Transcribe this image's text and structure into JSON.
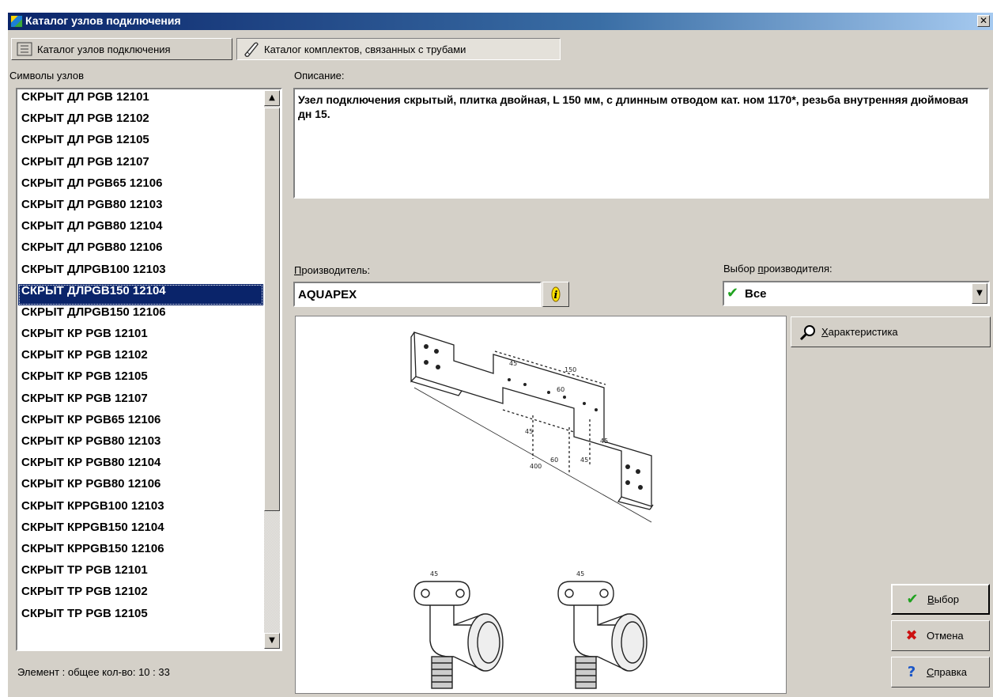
{
  "window": {
    "title": "Каталог узлов подключения",
    "close_glyph": "✕"
  },
  "tabs": [
    {
      "label": "Каталог узлов подключения",
      "icon": "list-icon"
    },
    {
      "label": "Каталог комплектов, связанных с трубами",
      "icon": "pipe-icon"
    }
  ],
  "list": {
    "label": "Символы узлов",
    "selected_index": 9,
    "items": [
      "СКРЫТ ДЛ PGB 12101",
      "СКРЫТ ДЛ PGB 12102",
      "СКРЫТ ДЛ PGB 12105",
      "СКРЫТ ДЛ PGB 12107",
      "СКРЫТ ДЛ PGB65 12106",
      "СКРЫТ ДЛ PGB80 12103",
      "СКРЫТ ДЛ PGB80 12104",
      "СКРЫТ ДЛ PGB80 12106",
      "СКРЫТ ДЛPGB100 12103",
      "СКРЫТ ДЛPGB150 12104",
      "СКРЫТ ДЛPGB150 12106",
      "СКРЫТ КР PGB 12101",
      "СКРЫТ КР PGB 12102",
      "СКРЫТ КР PGB 12105",
      "СКРЫТ КР PGB 12107",
      "СКРЫТ КР PGB65 12106",
      "СКРЫТ КР PGB80 12103",
      "СКРЫТ КР PGB80 12104",
      "СКРЫТ КР PGB80 12106",
      "СКРЫТ КРPGB100 12103",
      "СКРЫТ КРPGB150 12104",
      "СКРЫТ КРPGB150 12106",
      "СКРЫТ ТР PGB 12101",
      "СКРЫТ ТР PGB 12102",
      "СКРЫТ ТР PGB 12105"
    ]
  },
  "description": {
    "label": "Описание:",
    "text": "Узел подключения скрытый, плитка двойная, L 150 мм, с длинным отводом кат. ном 1170*, резьба внутренняя дюймовая дн 15."
  },
  "manufacturer": {
    "label_u": "П",
    "label_rest": "роизводитель:",
    "value": "AQUAPEX",
    "info_icon": "info-icon"
  },
  "manufacturer_select": {
    "label_pre": "Выбор ",
    "label_u": "п",
    "label_rest": "роизводителя:",
    "value": "Все",
    "icon": "check-icon"
  },
  "drawing": {
    "dims": [
      "150",
      "60",
      "45",
      "45",
      "45",
      "60",
      "45",
      "400",
      "45",
      "45"
    ]
  },
  "buttons": {
    "characteristic": {
      "u": "Х",
      "rest": "арактеристика"
    },
    "ok": {
      "u": "В",
      "rest": "ыбор"
    },
    "cancel": {
      "label": "Отмена"
    },
    "help": {
      "u": "С",
      "rest": "правка"
    }
  },
  "status": "Элемент : общее кол-во: 10 : 33",
  "colors": {
    "title_start": "#0a246a",
    "title_end": "#a6caf0",
    "selection": "#0a246a",
    "face": "#d4d0c8",
    "ok_check": "#1fa21f",
    "cancel_x": "#cc1111",
    "help": "#1a56c8"
  }
}
